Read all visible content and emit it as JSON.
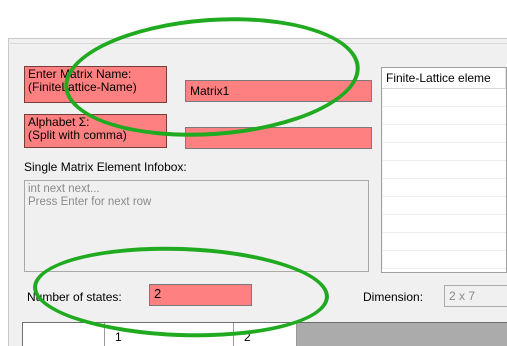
{
  "form": {
    "matrix_name_label": "Enter Matrix Name:\n(FiniteLattice-Name)",
    "matrix_name_value": "Matrix1",
    "alphabet_label": "Alphabet Σ:\n(Split with comma)",
    "alphabet_value": "",
    "infobox_label": "Single Matrix Element Infobox:",
    "infobox_text": "int next next...\nPress Enter for next row",
    "states_label": "Number of states:",
    "states_value": "2",
    "dimension_label": "Dimension:",
    "dimension_value": "2 x 7"
  },
  "listview": {
    "header": "Finite-Lattice eleme"
  },
  "grid": {
    "column_headers": [
      "1",
      "2"
    ]
  },
  "annotations": {
    "color": "#1faa1f"
  },
  "colors": {
    "required_field": "#ff8080",
    "window_bg": "#f0f0f0"
  }
}
